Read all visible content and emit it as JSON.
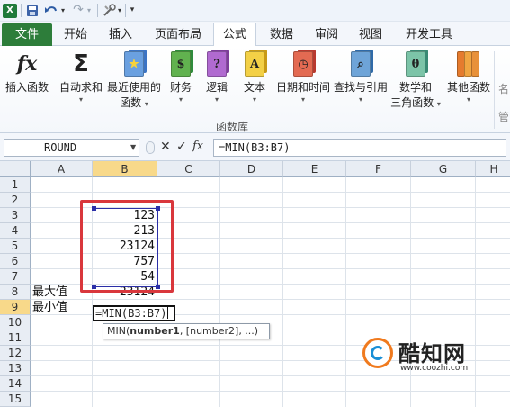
{
  "quick_access": {
    "redo_arrow": "↷",
    "dropdown": "▾"
  },
  "tabs": [
    {
      "id": "file",
      "label": "文件"
    },
    {
      "id": "home",
      "label": "开始"
    },
    {
      "id": "insert",
      "label": "插入"
    },
    {
      "id": "layout",
      "label": "页面布局"
    },
    {
      "id": "formulas",
      "label": "公式"
    },
    {
      "id": "data",
      "label": "数据"
    },
    {
      "id": "review",
      "label": "审阅"
    },
    {
      "id": "view",
      "label": "视图"
    },
    {
      "id": "developer",
      "label": "开发工具"
    }
  ],
  "ribbon": {
    "group_label": "函数库",
    "buttons": [
      {
        "id": "insert-function",
        "label": "插入函数",
        "label2": "",
        "icon": "fx-icon",
        "glyph": "fx"
      },
      {
        "id": "autosum",
        "label": "自动求和",
        "label2": "",
        "icon": "sigma-icon",
        "glyph": "Σ"
      },
      {
        "id": "recent",
        "label": "最近使用的",
        "label2": "函数",
        "icon": "star-book-icon",
        "glyph": "★"
      },
      {
        "id": "financial",
        "label": "财务",
        "label2": "",
        "icon": "financial-book-icon",
        "glyph": "$"
      },
      {
        "id": "logical",
        "label": "逻辑",
        "label2": "",
        "icon": "logical-book-icon",
        "glyph": "?"
      },
      {
        "id": "text",
        "label": "文本",
        "label2": "",
        "icon": "text-book-icon",
        "glyph": "A"
      },
      {
        "id": "datetime",
        "label": "日期和时间",
        "label2": "",
        "icon": "clock-book-icon",
        "glyph": "◷"
      },
      {
        "id": "lookup",
        "label": "查找与引用",
        "label2": "",
        "icon": "lookup-book-icon",
        "glyph": "⌕"
      },
      {
        "id": "math",
        "label": "数学和",
        "label2": "三角函数",
        "icon": "math-book-icon",
        "glyph": "θ"
      },
      {
        "id": "more",
        "label": "其他函数",
        "label2": "",
        "icon": "more-books-icon",
        "glyph": ""
      }
    ],
    "partial_label_1": "名",
    "partial_label_2": "管"
  },
  "formula_bar": {
    "name_box": "ROUND",
    "cancel_glyph": "✕",
    "enter_glyph": "✓",
    "fx_glyph": "fx",
    "formula": "=MIN(B3:B7)"
  },
  "columns": [
    "A",
    "B",
    "C",
    "D",
    "E",
    "F",
    "G",
    "H"
  ],
  "selected_column": "B",
  "rows": [
    "1",
    "2",
    "3",
    "4",
    "5",
    "6",
    "7",
    "8",
    "9",
    "10",
    "11",
    "12",
    "13",
    "14",
    "15"
  ],
  "selected_row": "9",
  "cells": {
    "b3": "123",
    "b4": "213",
    "b5": "23124",
    "b6": "757",
    "b7": "54",
    "a8": "最大值",
    "b8": "23124",
    "a9": "最小值",
    "b9_editing": "=MIN(B3:B7)"
  },
  "tooltip": {
    "fn": "MIN(",
    "arg1": "number1",
    "rest": ", [number2], ...)"
  },
  "watermark": {
    "title": "酷知网",
    "url": "www.coozhi.com"
  },
  "colors": {
    "file_tab": "#2d7d3a",
    "highlight_box": "#d9373c",
    "range_border": "#2b2fa8",
    "selected_header": "#f8d98a"
  }
}
